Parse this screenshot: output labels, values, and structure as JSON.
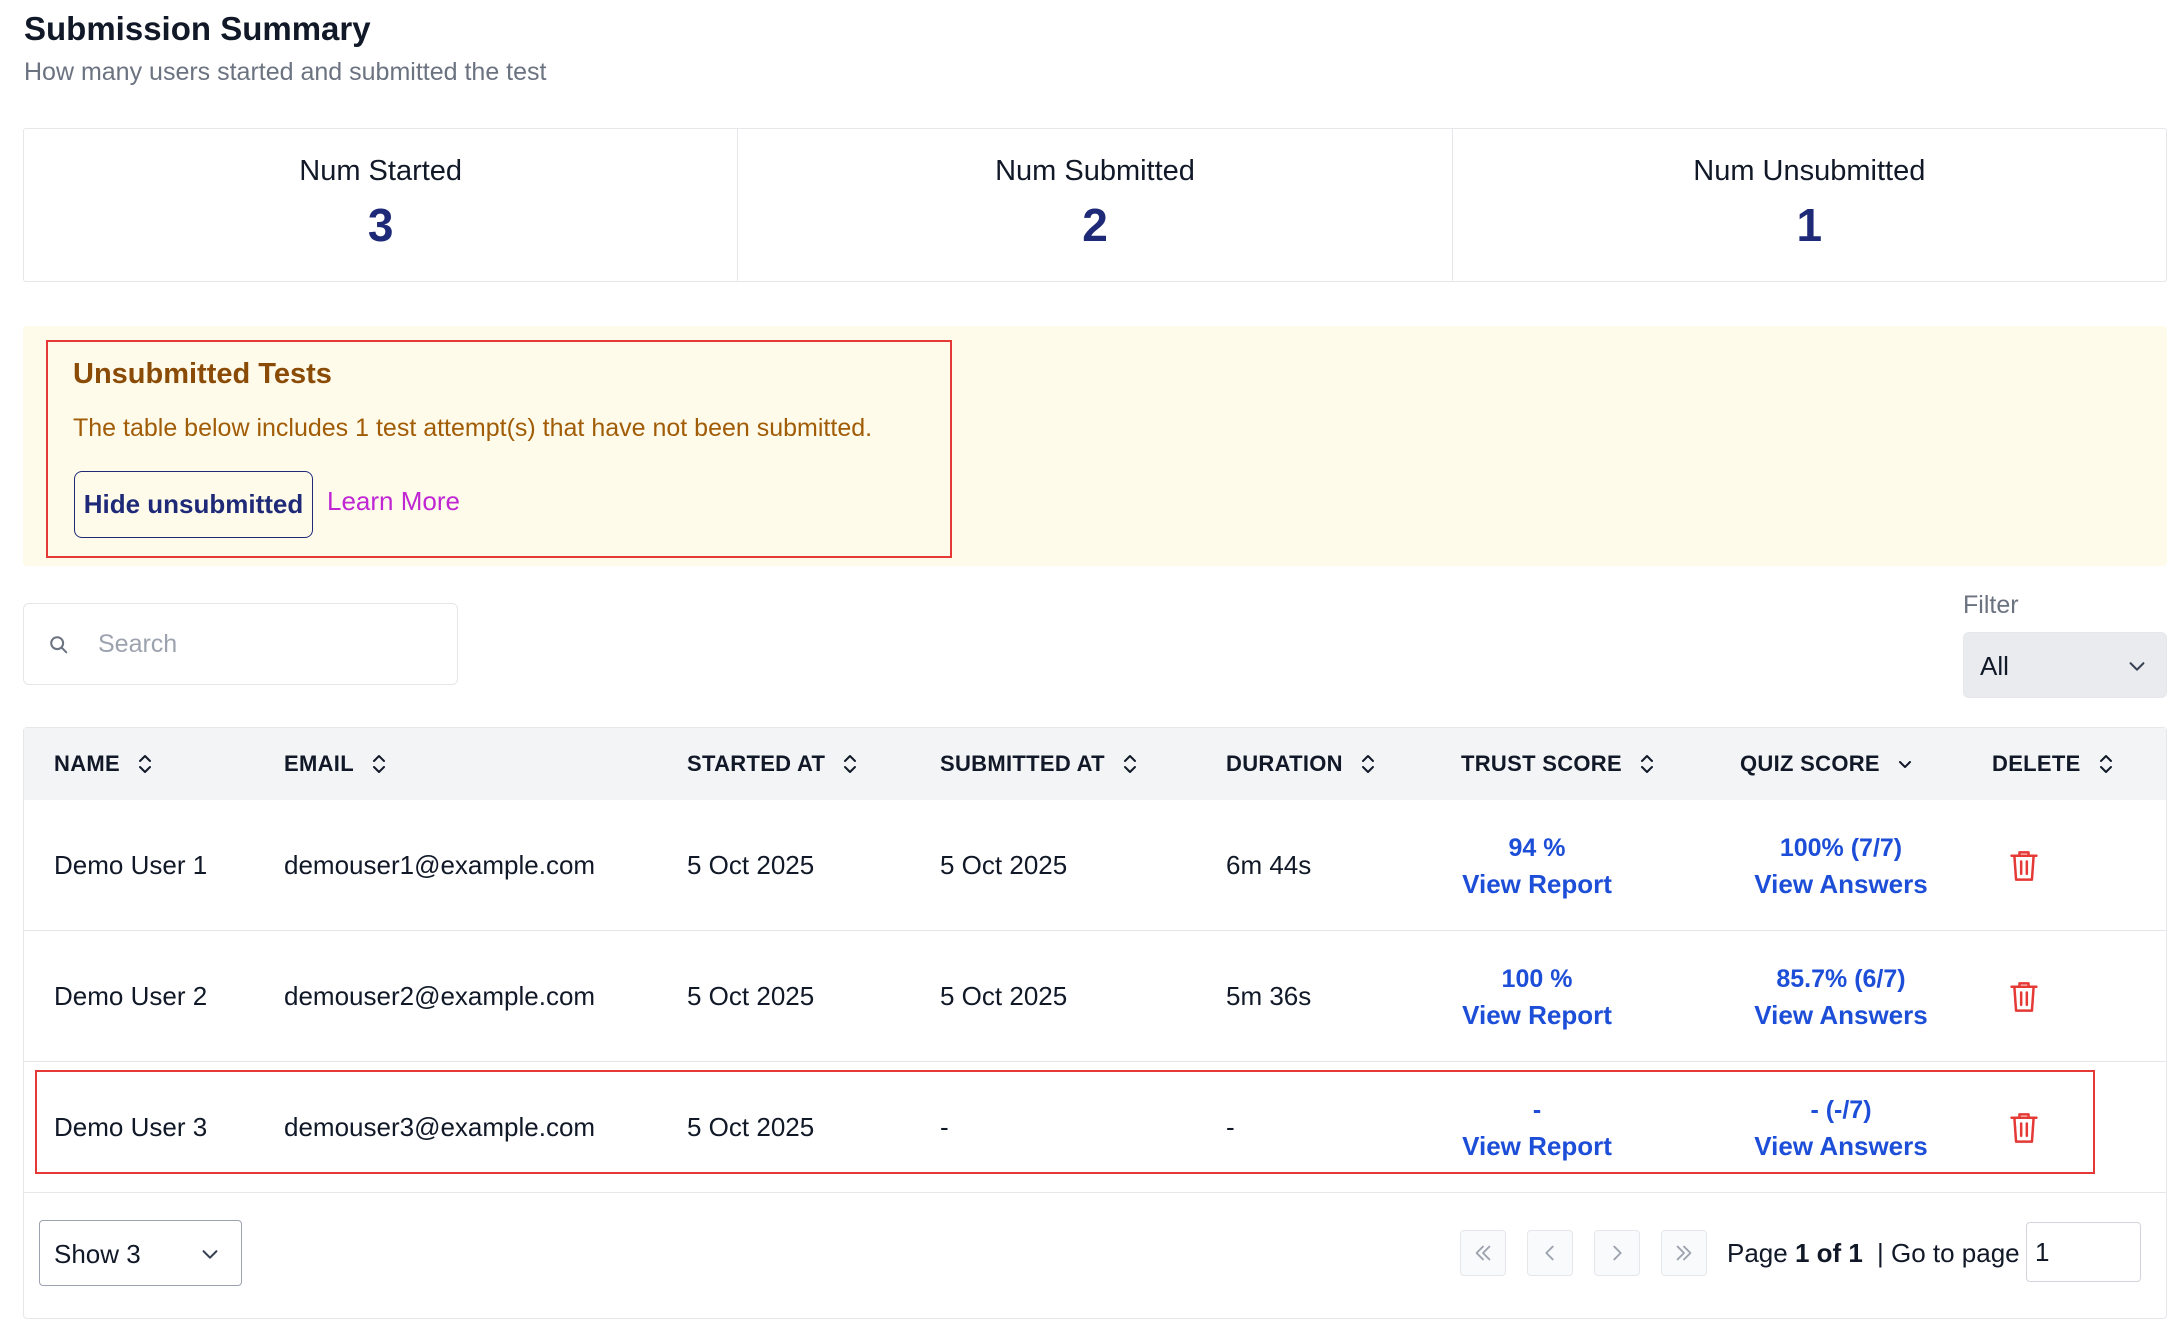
{
  "header": {
    "title": "Submission Summary",
    "subtitle": "How many users started and submitted the test"
  },
  "stats": [
    {
      "label": "Num Started",
      "value": "3"
    },
    {
      "label": "Num Submitted",
      "value": "2"
    },
    {
      "label": "Num Unsubmitted",
      "value": "1"
    }
  ],
  "banner": {
    "title": "Unsubmitted Tests",
    "text": "The table below includes 1 test attempt(s) that have not been submitted.",
    "hide_button": "Hide unsubmitted",
    "learn_more": "Learn More"
  },
  "search": {
    "placeholder": "Search",
    "icon": "search-icon"
  },
  "filter": {
    "label": "Filter",
    "value": "All"
  },
  "table": {
    "columns": [
      "NAME",
      "EMAIL",
      "STARTED AT",
      "SUBMITTED AT",
      "DURATION",
      "TRUST SCORE",
      "QUIZ SCORE",
      "DELETE"
    ],
    "rows": [
      {
        "name": "Demo User 1",
        "email": "demouser1@example.com",
        "started": "5 Oct 2025",
        "submitted": "5 Oct 2025",
        "duration": "6m 44s",
        "trust": "94 %",
        "trust_link": "View Report",
        "quiz": "100% (7/7)",
        "quiz_link": "View Answers"
      },
      {
        "name": "Demo User 2",
        "email": "demouser2@example.com",
        "started": "5 Oct 2025",
        "submitted": "5 Oct 2025",
        "duration": "5m 36s",
        "trust": "100 %",
        "trust_link": "View Report",
        "quiz": "85.7% (6/7)",
        "quiz_link": "View Answers"
      },
      {
        "name": "Demo User 3",
        "email": "demouser3@example.com",
        "started": "5 Oct 2025",
        "submitted": "-",
        "duration": "-",
        "trust": "-",
        "trust_link": "View Report",
        "quiz": "- (-/7)",
        "quiz_link": "View Answers"
      }
    ]
  },
  "pagination": {
    "show": "Show 3",
    "page_prefix": "Page ",
    "page_current": "1 of 1",
    "goto_label": "| Go to page",
    "goto_value": "1"
  },
  "colors": {
    "accent": "#1e2a78",
    "link": "#1d4ed8",
    "warning_bg": "#fffbea",
    "warning_text": "#8a4b06",
    "highlight": "#e53935",
    "danger": "#e53935"
  }
}
